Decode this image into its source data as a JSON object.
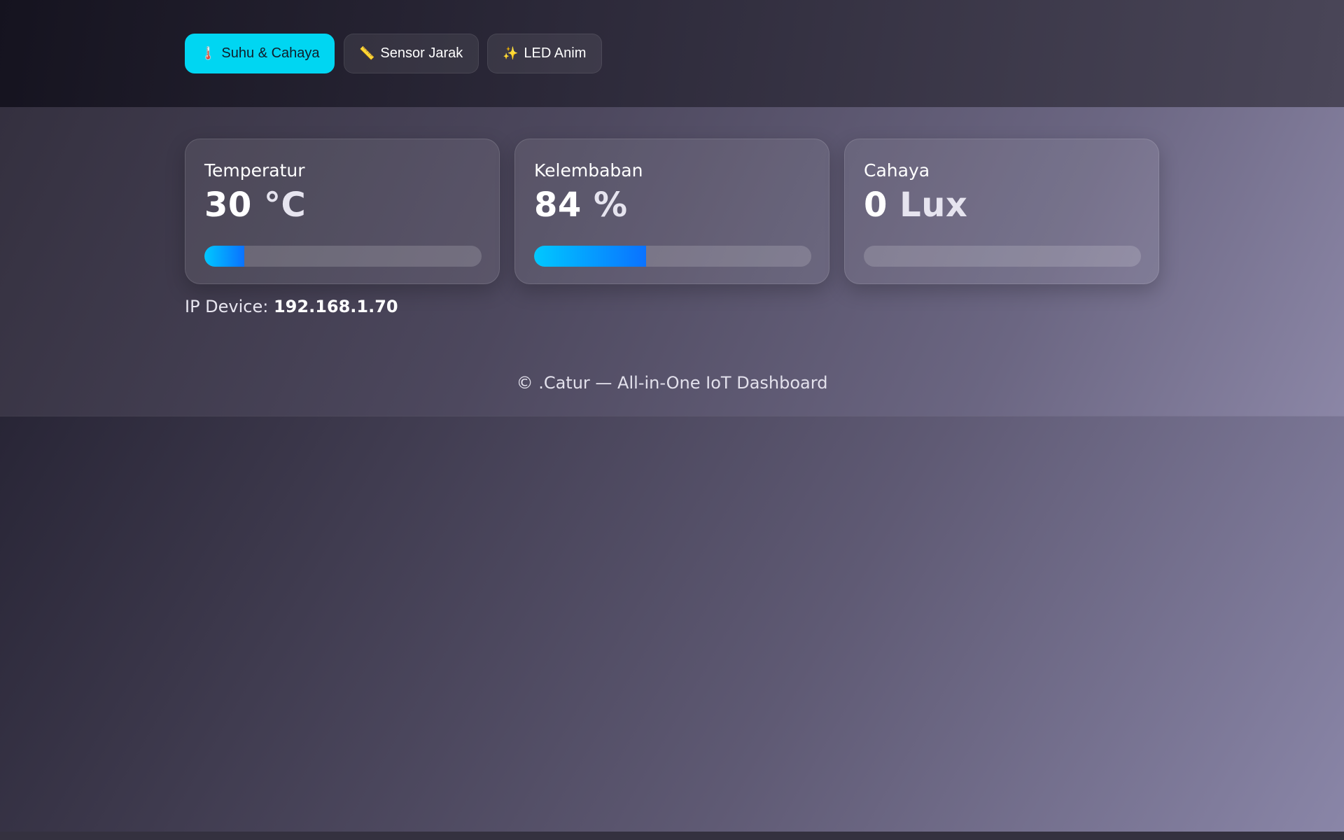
{
  "tabs": [
    {
      "icon": "🌡️",
      "icon_name": "thermometer-icon",
      "label": "Suhu & Cahaya",
      "active": true
    },
    {
      "icon": "📏",
      "icon_name": "ruler-icon",
      "label": "Sensor Jarak",
      "active": false
    },
    {
      "icon": "✨",
      "icon_name": "sparkles-icon",
      "label": "LED Anim",
      "active": false
    }
  ],
  "cards": [
    {
      "label": "Temperatur",
      "value": "30",
      "unit": "°C",
      "bar_fraction": 0.145
    },
    {
      "label": "Kelembaban",
      "value": "84",
      "unit": "%",
      "bar_fraction": 0.405
    },
    {
      "label": "Cahaya",
      "value": "0",
      "unit": "Lux",
      "bar_fraction": 0
    }
  ],
  "device": {
    "ip_label": "IP Device:",
    "ip_value": "192.168.1.70"
  },
  "footer": {
    "text": "© .Catur — All-in-One IoT Dashboard"
  },
  "colors": {
    "accent_tab": "#00d6f2",
    "bar_start": "#00c8ff",
    "bar_end": "#0a72ff"
  }
}
